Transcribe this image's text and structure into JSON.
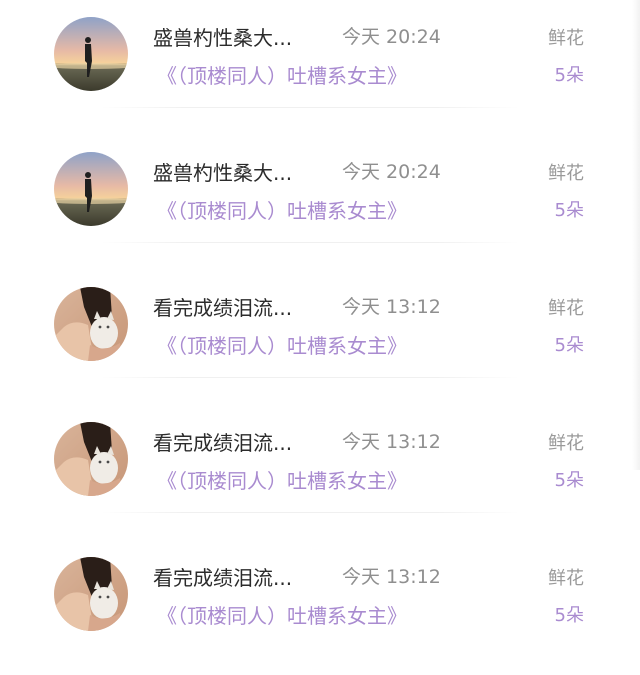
{
  "list": {
    "rows": [
      {
        "name": "盛兽杓性桑大...",
        "time": "今天 20:24",
        "book": "《（顶楼同人）吐槽系女主》",
        "gift_label": "鲜花",
        "gift_count": "5朵",
        "avatar_icon": "silhouette-sunset-icon"
      },
      {
        "name": "盛兽杓性桑大...",
        "time": "今天 20:24",
        "book": "《（顶楼同人）吐槽系女主》",
        "gift_label": "鲜花",
        "gift_count": "5朵",
        "avatar_icon": "silhouette-sunset-icon"
      },
      {
        "name": "看完成绩泪流...",
        "time": "今天 13:12",
        "book": "《（顶楼同人）吐槽系女主》",
        "gift_label": "鲜花",
        "gift_count": "5朵",
        "avatar_icon": "girl-with-cat-icon"
      },
      {
        "name": "看完成绩泪流...",
        "time": "今天 13:12",
        "book": "《（顶楼同人）吐槽系女主》",
        "gift_label": "鲜花",
        "gift_count": "5朵",
        "avatar_icon": "girl-with-cat-icon"
      },
      {
        "name": "看完成绩泪流...",
        "time": "今天 13:12",
        "book": "《（顶楼同人）吐槽系女主》",
        "gift_label": "鲜花",
        "gift_count": "5朵",
        "avatar_icon": "girl-with-cat-icon"
      }
    ]
  },
  "colors": {
    "accent": "#a98bd0",
    "name_text": "#2b2b2b",
    "muted_text": "#8f8f8f"
  }
}
